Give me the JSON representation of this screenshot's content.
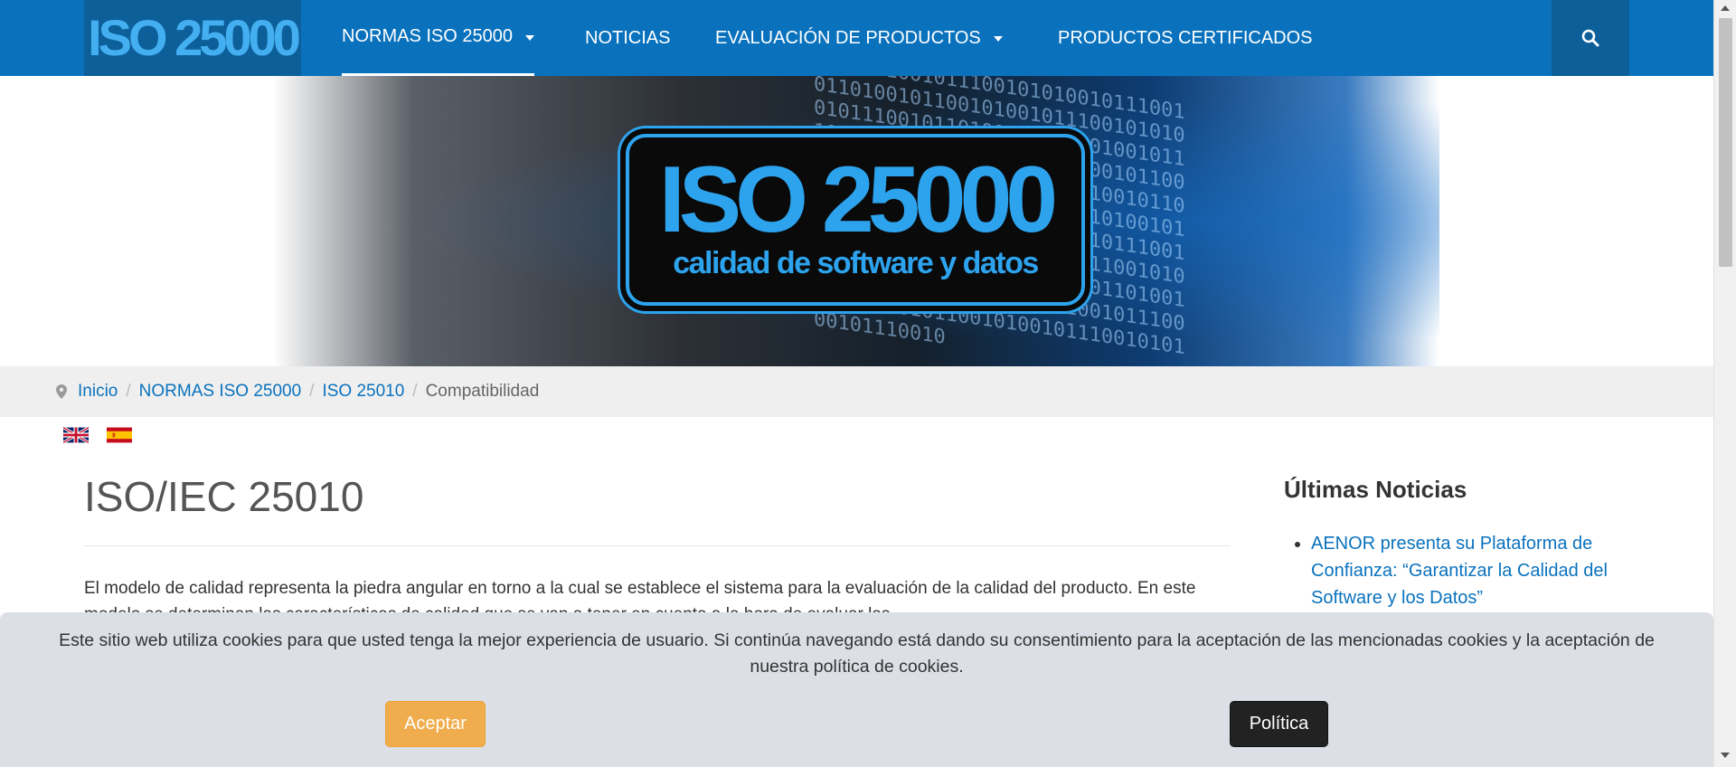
{
  "nav": {
    "logo": "ISO 25000",
    "items": [
      {
        "label": "NORMAS ISO 25000",
        "dropdown": true,
        "active": true
      },
      {
        "label": "NOTICIAS",
        "dropdown": false,
        "active": false
      },
      {
        "label": "EVALUACIÓN DE PRODUCTOS",
        "dropdown": true,
        "active": false
      },
      {
        "label": "PRODUCTOS CERTIFICADOS",
        "dropdown": false,
        "active": false
      }
    ],
    "search_icon": "search-icon"
  },
  "banner": {
    "title": "ISO 25000",
    "subtitle": "calidad de software y datos",
    "digits": "1100101001011100101010010111001011010010110010100101110010101001011100101101001011001010010111001010100101110010110100101100101001011100101010010111001011010010110010100101110010101001011100101101001011001010010111001010100101110010110100101100101001011100101010010111001011010010110010100101110010101001011100101101001011001010010111001010100101110010"
  },
  "breadcrumb": {
    "icon": "map-marker-icon",
    "items": [
      "Inicio",
      "NORMAS ISO 25000",
      "ISO 25010"
    ],
    "current": "Compatibilidad"
  },
  "languages": [
    "English",
    "Español"
  ],
  "main": {
    "title": "ISO/IEC 25010",
    "text": "El modelo de calidad representa la piedra angular en torno a la cual se establece el sistema para la evaluación de la calidad del producto. En este modelo se determinan las características de calidad que se van a tener en cuenta a la hora de evaluar las"
  },
  "sidebar": {
    "title": "Últimas Noticias",
    "news": [
      "AENOR presenta su Plataforma de Confianza: “Garantizar la Calidad del Software y los Datos”"
    ]
  },
  "cookie": {
    "text": "Este sitio web utiliza cookies para que usted tenga la mejor experiencia de usuario. Si continúa navegando está dando su consentimiento para la aceptación de las mencionadas cookies y la aceptación de nuestra política de cookies.",
    "accept_label": "Aceptar",
    "policy_label": "Política"
  },
  "colors": {
    "navbar": "#0a72bd",
    "navbar_dark": "#0d5f99",
    "link": "#0a72bd",
    "accept": "#f0ad4e",
    "policy": "#222222"
  }
}
